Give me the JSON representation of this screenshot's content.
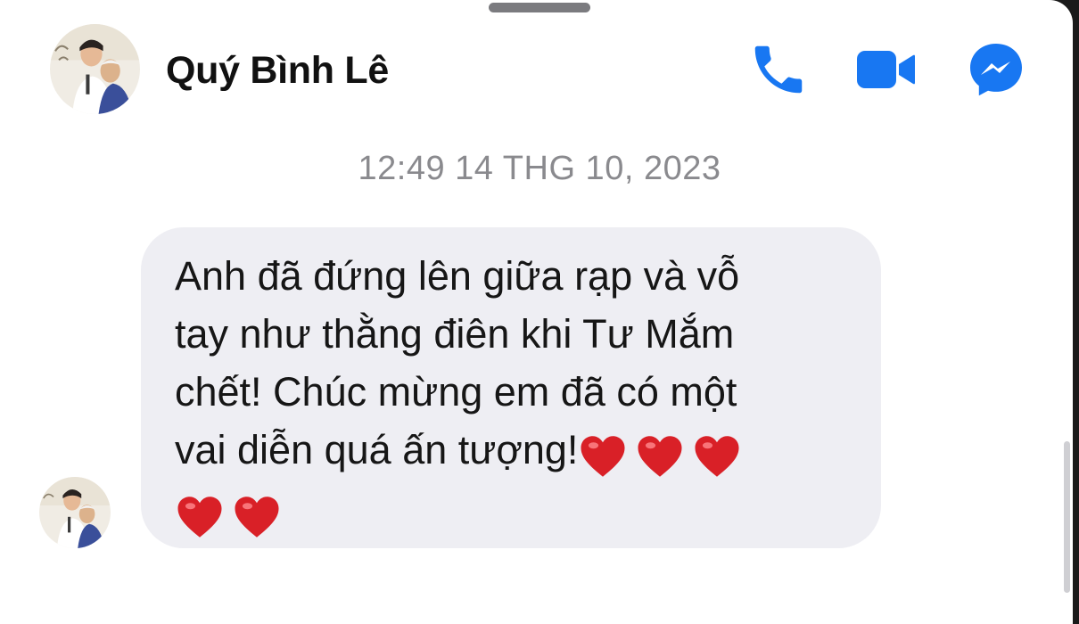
{
  "header": {
    "contact_name": "Quý Bình Lê",
    "icons": [
      "phone-icon",
      "video-camera-icon",
      "messenger-icon"
    ]
  },
  "conversation": {
    "timestamp": "12:49 14 THG 10, 2023",
    "message": {
      "lines": [
        "Anh đã đứng lên giữa rạp và vỗ",
        "tay như thằng điên khi Tư Mắm",
        "chết! Chúc mừng em đã có một",
        "vai diễn quá ấn tượng!"
      ],
      "emoji": [
        "❤️",
        "❤️",
        "❤️",
        "❤️",
        "❤️"
      ]
    }
  },
  "colors": {
    "accent": "#1877f2",
    "bubble_background": "#eeeef3",
    "timestamp_text": "#8a8a8e",
    "heart": "#d92027"
  }
}
